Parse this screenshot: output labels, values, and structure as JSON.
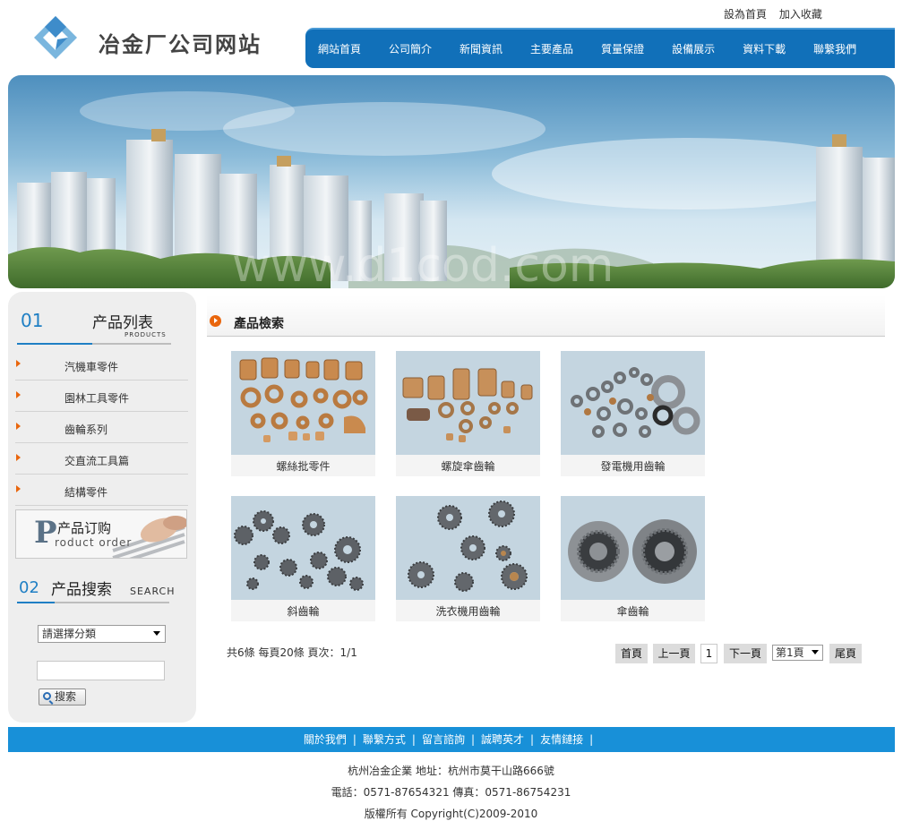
{
  "header": {
    "logo_text": "冶金厂公司网站",
    "top_links": [
      "設為首頁",
      "加入收藏"
    ],
    "nav": [
      "網站首頁",
      "公司簡介",
      "新聞資訊",
      "主要產品",
      "質量保證",
      "設備展示",
      "資料下載",
      "聯繫我們"
    ]
  },
  "banner": {
    "watermark": "www.d1cod.com"
  },
  "sidebar": {
    "products_num": "01",
    "products_title": "产品列表",
    "products_sub": "PRODUCTS",
    "categories": [
      "汽機車零件",
      "園林工具零件",
      "齒輪系列",
      "交直流工具篇",
      "結構零件"
    ],
    "order_cn": "产品订购",
    "order_en": "roduct order",
    "search_num": "02",
    "search_title": "产品搜索",
    "search_en": "SEARCH",
    "select_value": "請選擇分類",
    "search_button": "搜索"
  },
  "main": {
    "title": "產品檢索",
    "products": [
      "螺絲批零件",
      "螺旋傘齒輪",
      "發電機用齒輪",
      "斜齒輪",
      "洗衣機用齒輪",
      "傘齒輪"
    ],
    "pager_info": "共6條 每頁20條 頁次：1/1",
    "pager": {
      "first": "首頁",
      "prev": "上一頁",
      "current": "1",
      "next": "下一頁",
      "select": "第1頁",
      "last": "尾頁"
    }
  },
  "footer": {
    "links": [
      "關於我們",
      "聯繫方式",
      "留言諮詢",
      "誠聘英才",
      "友情鏈接"
    ],
    "separator": "|",
    "address": "杭州冶金企業 地址：杭州市莫干山路666號",
    "phone": "電話：0571-87654321 傳真：0571-86754231",
    "copyright": "版權所有 Copyright(C)2009-2010"
  },
  "colors": {
    "nav_blue": "#1170b9",
    "footer_blue": "#1890d8",
    "accent_orange": "#e9660d",
    "brand_blue": "#1f7fc4"
  }
}
